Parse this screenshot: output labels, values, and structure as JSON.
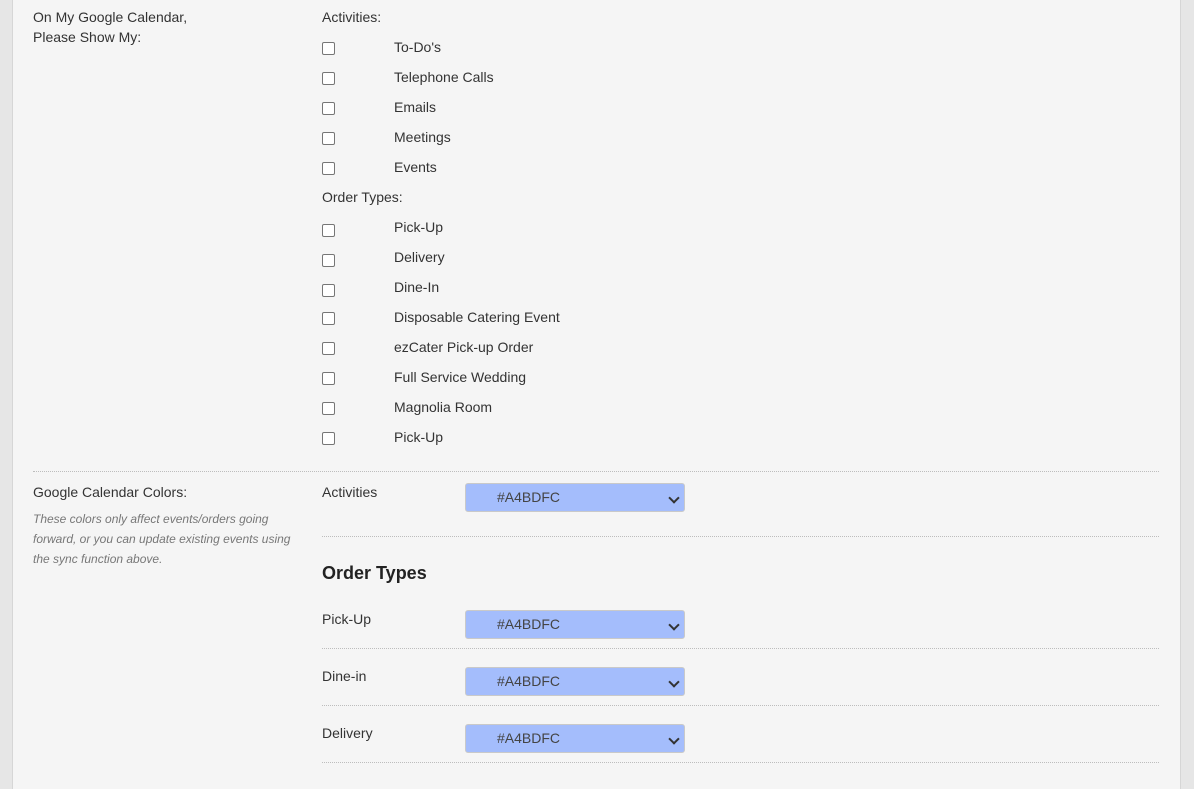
{
  "show_section": {
    "label_line1": "On My Google Calendar,",
    "label_line2": "Please Show My:",
    "activities_heading": "Activities:",
    "activities": [
      {
        "label": "To-Do's",
        "checked": false
      },
      {
        "label": "Telephone Calls",
        "checked": false
      },
      {
        "label": "Emails",
        "checked": false
      },
      {
        "label": "Meetings",
        "checked": false
      },
      {
        "label": "Events",
        "checked": false
      }
    ],
    "order_types_heading": "Order Types:",
    "order_types": [
      {
        "label": "Pick-Up",
        "checked": false
      },
      {
        "label": "Delivery",
        "checked": false
      },
      {
        "label": "Dine-In",
        "checked": false
      },
      {
        "label": "Disposable Catering Event",
        "checked": false
      },
      {
        "label": "ezCater Pick-up Order",
        "checked": false
      },
      {
        "label": "Full Service Wedding",
        "checked": false
      },
      {
        "label": "Magnolia Room",
        "checked": false
      },
      {
        "label": "Pick-Up",
        "checked": false
      }
    ]
  },
  "colors_section": {
    "label": "Google Calendar Colors:",
    "note": "These colors only affect events/orders going forward, or you can update existing events using the sync function above.",
    "activities_label": "Activities",
    "activities_color": "#A4BDFC",
    "order_types_heading": "Order Types",
    "order_type_colors": [
      {
        "label": "Pick-Up",
        "color": "#A4BDFC"
      },
      {
        "label": "Dine-in",
        "color": "#A4BDFC"
      },
      {
        "label": "Delivery",
        "color": "#A4BDFC"
      }
    ]
  }
}
